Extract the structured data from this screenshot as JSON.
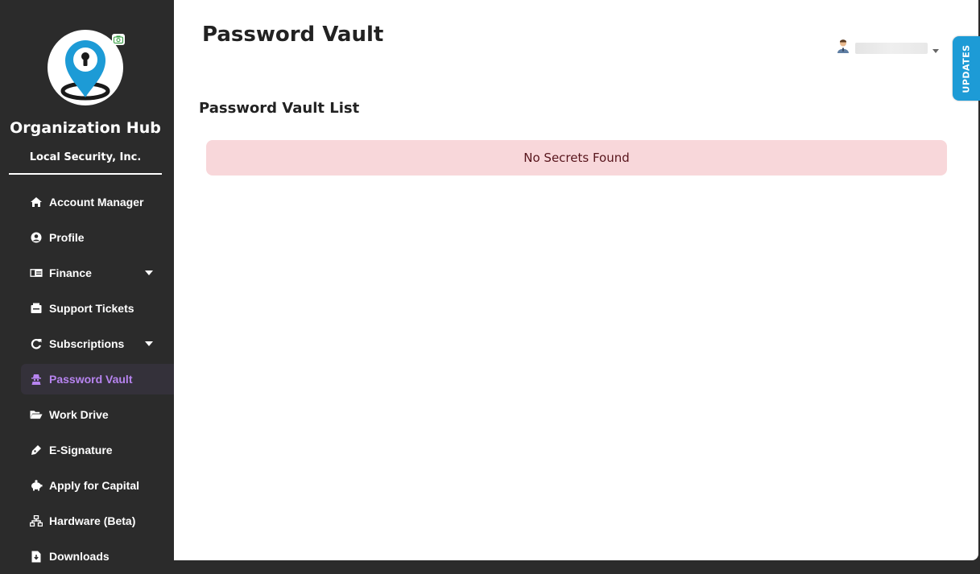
{
  "sidebar": {
    "org_title": "Organization Hub",
    "org_subtitle": "Local Security, Inc.",
    "items": [
      {
        "label": "Account Manager",
        "icon": "home-icon"
      },
      {
        "label": "Profile",
        "icon": "user-circle-icon"
      },
      {
        "label": "Finance",
        "icon": "money-icon",
        "has_dropdown": true
      },
      {
        "label": "Support Tickets",
        "icon": "ticket-icon"
      },
      {
        "label": "Subscriptions",
        "icon": "refresh-icon",
        "has_dropdown": true
      },
      {
        "label": "Password Vault",
        "icon": "user-secret-icon",
        "active": true
      },
      {
        "label": "Work Drive",
        "icon": "folder-open-icon"
      },
      {
        "label": "E-Signature",
        "icon": "pen-icon"
      },
      {
        "label": "Apply for Capital",
        "icon": "piggy-bank-icon"
      },
      {
        "label": "Hardware (Beta)",
        "icon": "network-icon"
      },
      {
        "label": "Downloads",
        "icon": "file-download-icon"
      }
    ]
  },
  "header": {
    "title": "Password Vault"
  },
  "main": {
    "section_title": "Password Vault List",
    "empty_message": "No Secrets Found"
  },
  "updates_tab": {
    "label": "UPDATES"
  },
  "colors": {
    "sidebar_bg": "#2b2b2b",
    "active_item": "#b784f0",
    "alert_bg": "#f8d7da",
    "alert_text": "#58151c",
    "updates_tab": "#1d9bd6",
    "logo_blue": "#1d9bd6"
  }
}
